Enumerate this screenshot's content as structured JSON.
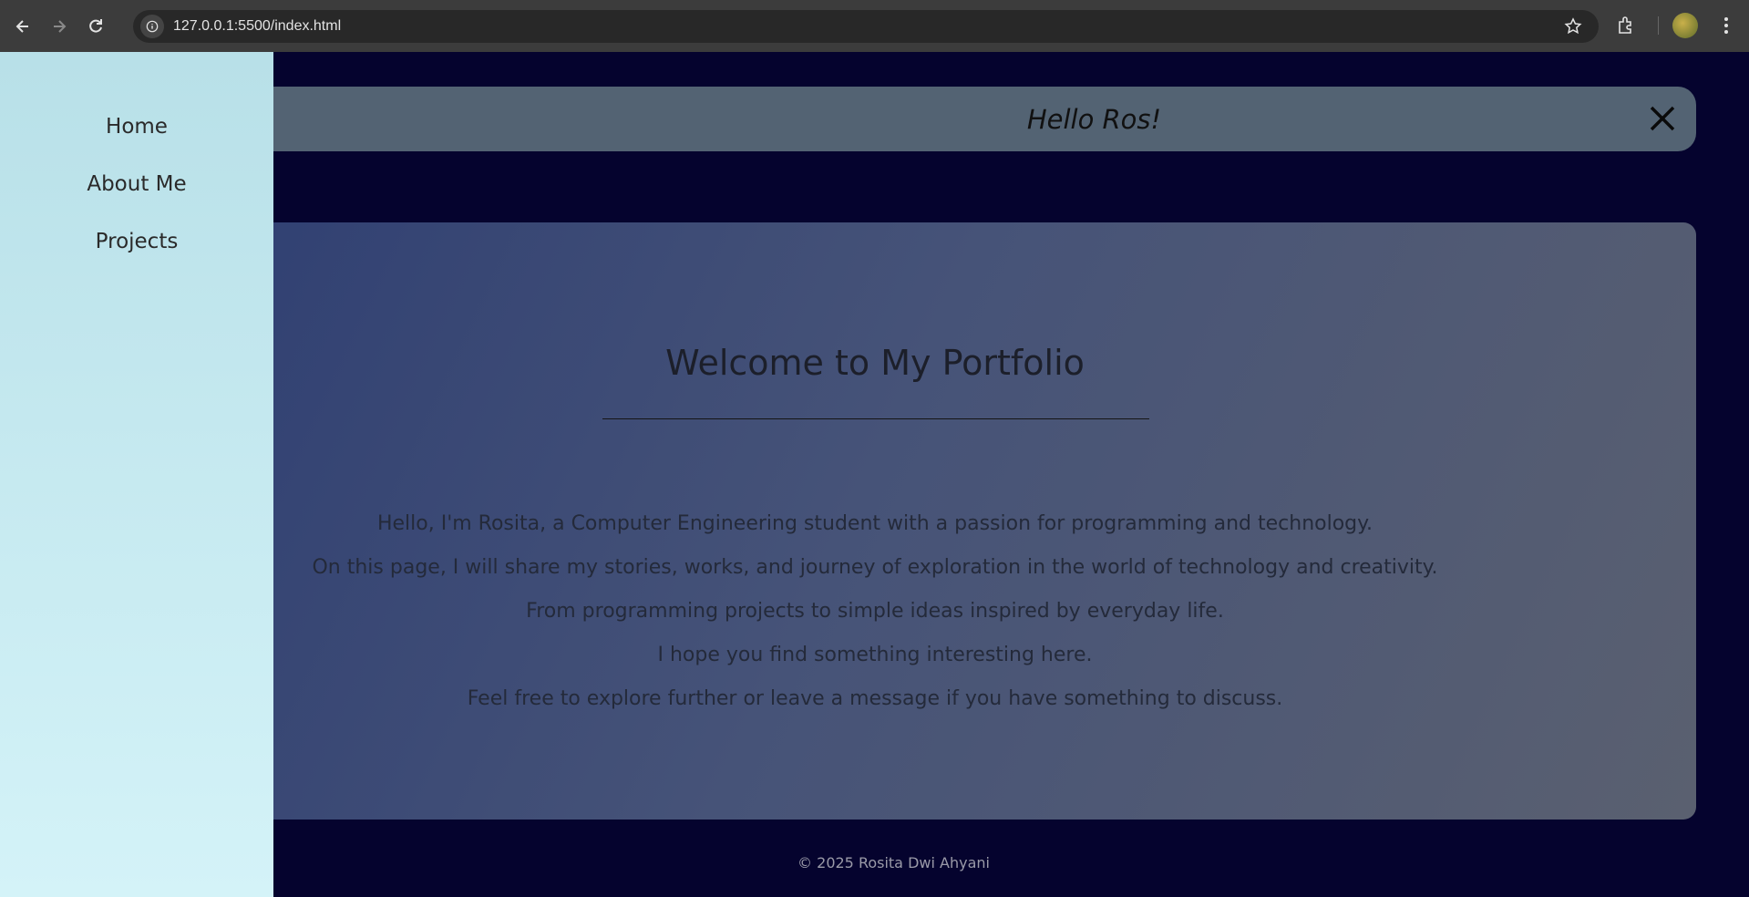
{
  "browser": {
    "url": "127.0.0.1:5500/index.html",
    "icons": [
      "back-arrow-icon",
      "forward-arrow-icon",
      "reload-icon",
      "site-info-icon",
      "bookmark-star-icon",
      "extensions-icon",
      "profile-avatar",
      "kebab-menu-icon"
    ]
  },
  "sidebar": {
    "items": [
      {
        "label": "Home"
      },
      {
        "label": "About Me"
      },
      {
        "label": "Projects"
      }
    ]
  },
  "header": {
    "title": "Hello Ros!",
    "close_icon": "close-icon"
  },
  "main": {
    "title": "Welcome to My Portfolio",
    "paragraphs": [
      "Hello, I'm Rosita, a Computer Engineering student with a passion for programming and technology.",
      "On this page, I will share my stories, works, and journey of exploration in the world of technology and creativity.",
      "From programming projects to simple ideas inspired by everyday life.",
      "I hope you find something interesting here.",
      "Feel free to explore further or leave a message if you have something to discuss."
    ]
  },
  "footer": {
    "text": "© 2025 Rosita Dwi Ahyani"
  },
  "colors": {
    "background": "#05032e",
    "sidebar": "#c6ebf1",
    "header": "#536373",
    "card_start": "#2f3f72",
    "card_end": "#5a6070"
  }
}
